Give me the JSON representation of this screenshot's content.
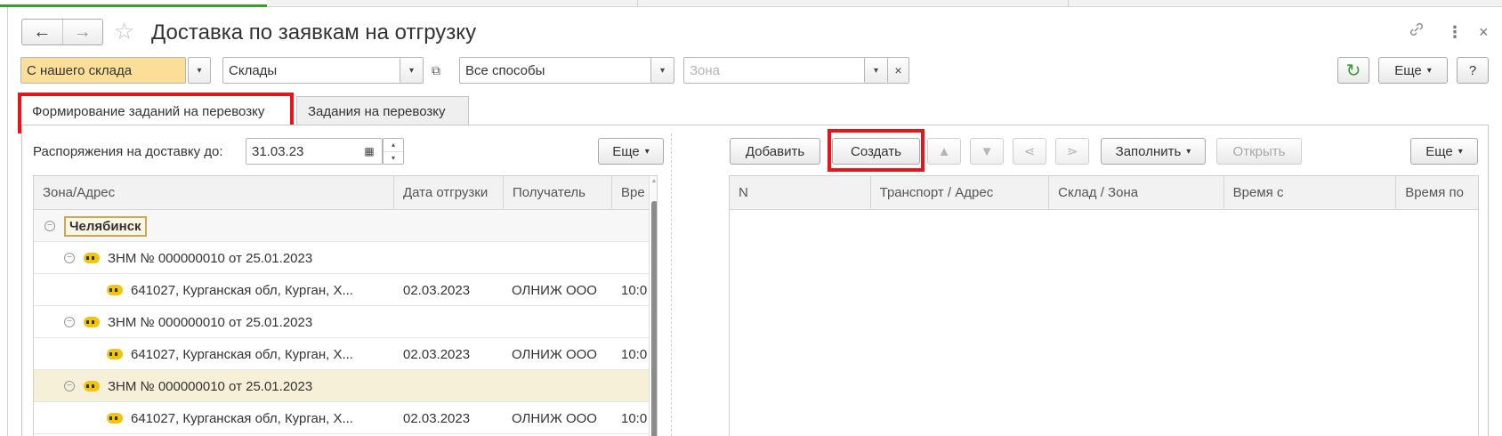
{
  "window": {
    "title": "Доставка по заявкам на отгрузку",
    "back_glyph": "←",
    "forward_glyph": "→",
    "star_glyph": "☆",
    "link_glyph": "🔗",
    "menu_glyph": "⋮",
    "close_glyph": "×"
  },
  "filters": {
    "source": "С нашего склада",
    "warehouses": "Склады",
    "methods": "Все способы",
    "zone_placeholder": "Зона",
    "clear_glyph": "×",
    "copy_glyph": "⧉"
  },
  "toolbar": {
    "refresh_glyph": "↻",
    "more_label": "Еще",
    "help_label": "?",
    "caret": "▾"
  },
  "tabs": [
    {
      "label": "Формирование заданий на перевозку"
    },
    {
      "label": "Задания на перевозку"
    }
  ],
  "left": {
    "deadline_label": "Распоряжения на доставку до:",
    "deadline_value": "31.03.23",
    "calendar_glyph": "▦",
    "more_label": "Еще",
    "columns": [
      "Зона/Адрес",
      "Дата отгрузки",
      "Получатель",
      "Вре"
    ],
    "group": "Челябинск",
    "rows": [
      {
        "type": "order",
        "text": "ЗНМ № 000000010 от 25.01.2023",
        "date": "",
        "recipient": "",
        "time": ""
      },
      {
        "type": "address",
        "text": "641027, Курганская обл, Курган, Х...",
        "date": "02.03.2023",
        "recipient": "ОЛНИЖ ООО",
        "time": "10:0"
      },
      {
        "type": "order",
        "text": "ЗНМ № 000000010 от 25.01.2023",
        "date": "",
        "recipient": "",
        "time": ""
      },
      {
        "type": "address",
        "text": "641027, Курганская обл, Курган, Х...",
        "date": "02.03.2023",
        "recipient": "ОЛНИЖ ООО",
        "time": "10:0"
      },
      {
        "type": "order",
        "text": "ЗНМ № 000000010 от 25.01.2023",
        "date": "",
        "recipient": "",
        "time": "",
        "highlighted": true
      },
      {
        "type": "address",
        "text": "641027, Курганская обл, Курган, Х...",
        "date": "02.03.2023",
        "recipient": "ОЛНИЖ ООО",
        "time": "10:0"
      }
    ]
  },
  "right": {
    "add_label": "Добавить",
    "create_label": "Создать",
    "fill_label": "Заполнить",
    "open_label": "Открыть",
    "more_label": "Еще",
    "up_glyph": "▲",
    "down_glyph": "▼",
    "merge_glyph": "⋖",
    "split_glyph": "⋗",
    "columns": [
      "N",
      "Транспорт / Адрес",
      "Склад / Зона",
      "Время с",
      "Время по"
    ]
  },
  "colors": {
    "accent_red": "#e8141a",
    "filter_yellow": "#fbdf99",
    "row_highlight": "#f6f0d9",
    "refresh_green": "#3d9b35"
  }
}
